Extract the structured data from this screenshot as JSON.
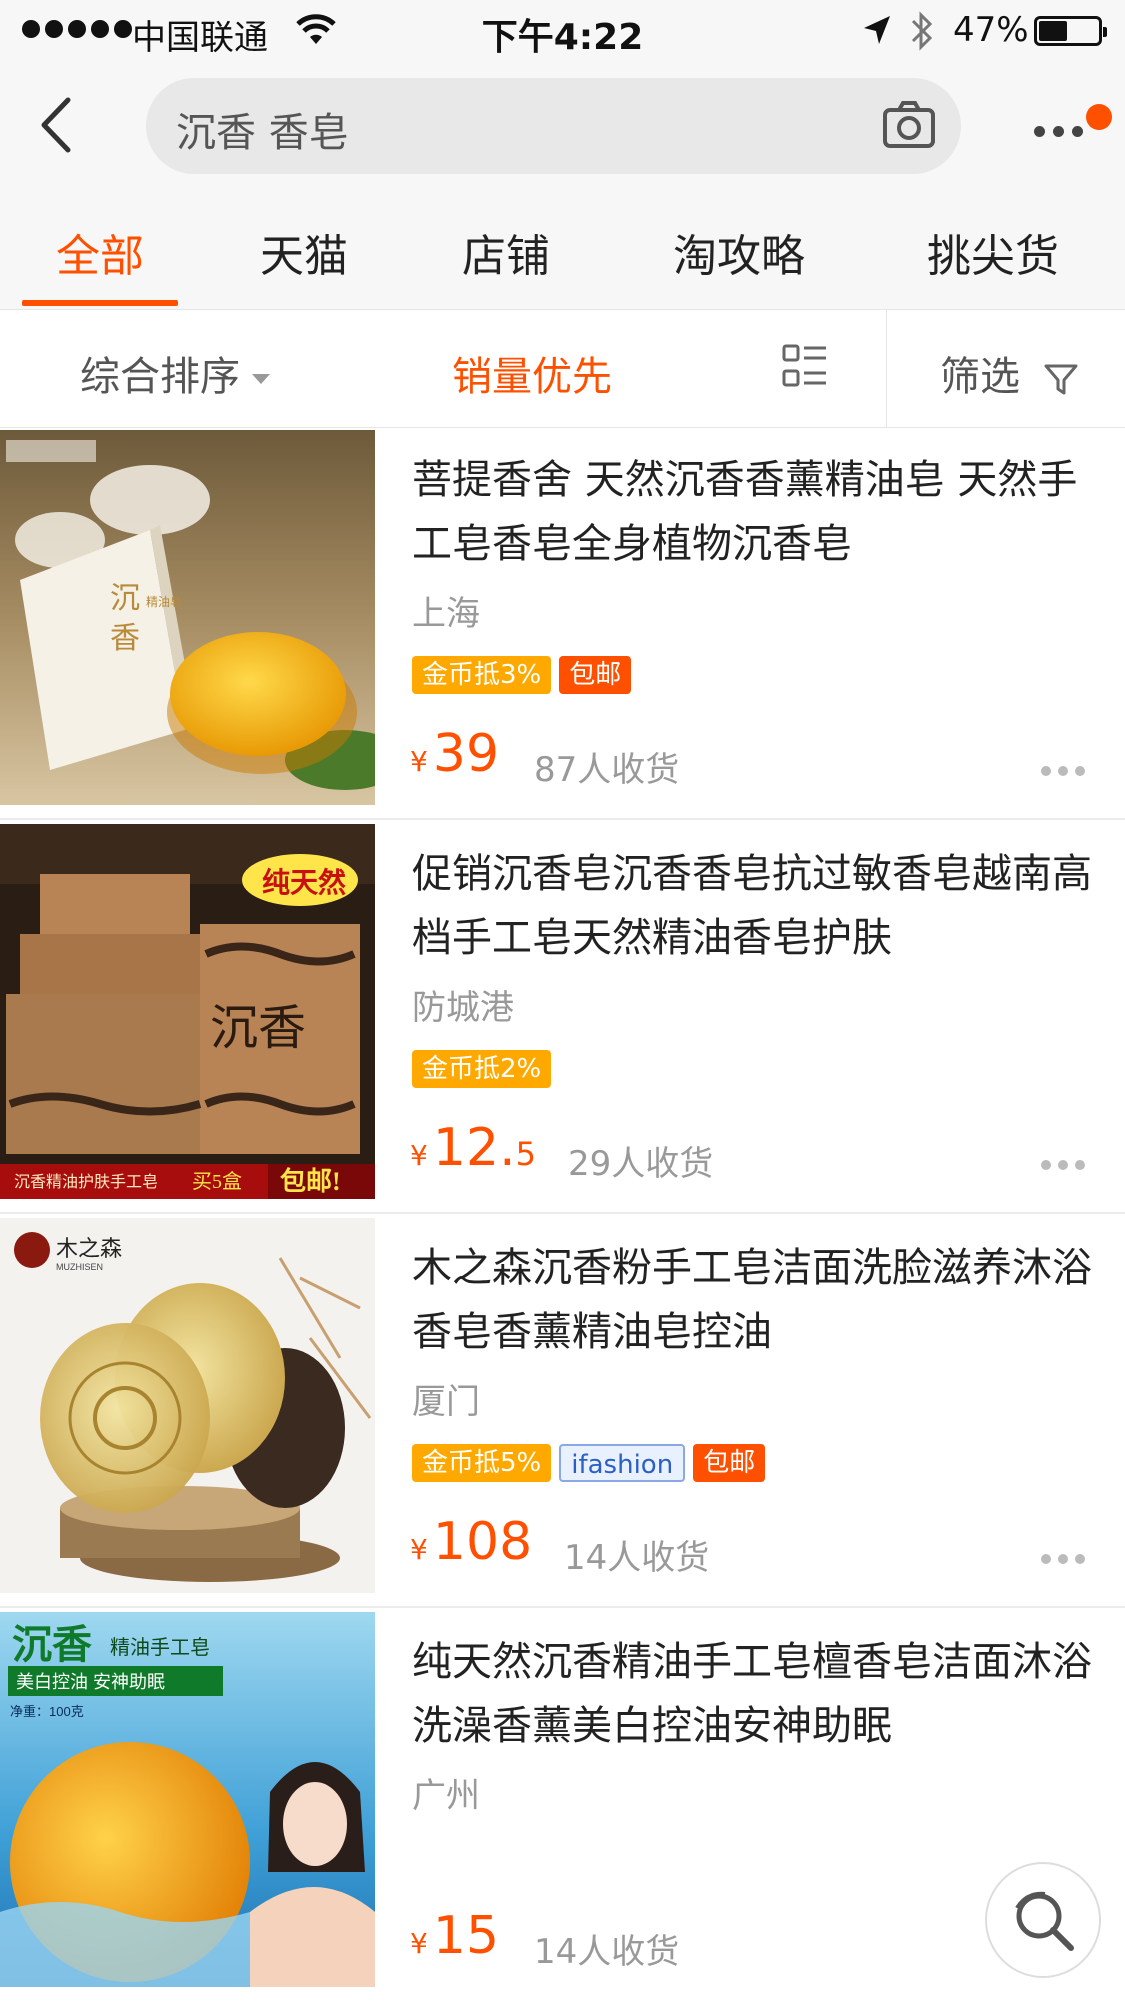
{
  "status_bar": {
    "carrier": "中国联通",
    "time": "下午4:22",
    "battery": "47%",
    "battery_level": 0.47
  },
  "search": {
    "query": "沉香 香皂"
  },
  "tabs": [
    {
      "label": "全部",
      "active": true
    },
    {
      "label": "天猫",
      "active": false
    },
    {
      "label": "店铺",
      "active": false
    },
    {
      "label": "淘攻略",
      "active": false
    },
    {
      "label": "挑尖货",
      "active": false
    }
  ],
  "sort": {
    "comprehensive": "综合排序",
    "sales_first": "销量优先",
    "filter": "筛选"
  },
  "colors": {
    "accent": "#ff5000",
    "coin_tag": "#ffa900",
    "muted": "#999999"
  },
  "items": [
    {
      "title": "菩提香舍  天然沉香香薰精油皂 天然手工皂香皂全身植物沉香皂",
      "location": "上海",
      "tags": [
        "金币抵3%",
        "包邮"
      ],
      "price_symbol": "¥",
      "price_int": "39",
      "price_dec": "",
      "sales": "87人收货",
      "image_text": [
        "沉",
        "香",
        "精油皂"
      ]
    },
    {
      "title": "促销沉香皂沉香香皂抗过敏香皂越南高档手工皂天然精油香皂护肤",
      "location": "防城港",
      "tags": [
        "金币抵2%"
      ],
      "price_symbol": "¥",
      "price_int": "12.",
      "price_dec": "5",
      "sales": "29人收货",
      "image_text": [
        "纯天然",
        "沉香",
        "沉香精油护肤手工皂",
        "买5盒",
        "包邮!"
      ]
    },
    {
      "title": "木之森沉香粉手工皂洁面洗脸滋养沐浴香皂香薰精油皂控油",
      "location": "厦门",
      "tags": [
        "金币抵5%",
        "ifashion",
        "包邮"
      ],
      "price_symbol": "¥",
      "price_int": "108",
      "price_dec": "",
      "sales": "14人收货",
      "image_text": [
        "木之森",
        "MUZHISEN"
      ]
    },
    {
      "title": "纯天然沉香精油手工皂檀香皂洁面沐浴洗澡香薰美白控油安神助眠",
      "location": "广州",
      "tags": [],
      "price_symbol": "¥",
      "price_int": "15",
      "price_dec": "",
      "sales": "14人收货",
      "image_text": [
        "沉香",
        "精油手工皂",
        "美白控油 安神助眠",
        "净重：100克"
      ]
    }
  ]
}
